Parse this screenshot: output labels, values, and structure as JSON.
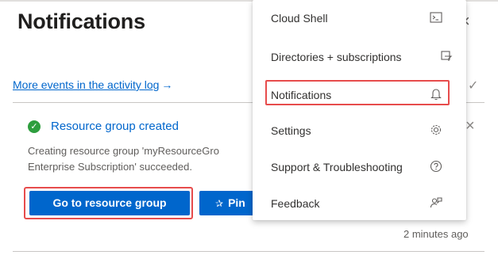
{
  "panel": {
    "title": "Notifications",
    "close_glyph": "×",
    "events_link": "More events in the activity log",
    "events_arrow": "→",
    "dismiss_all_glyph": "✓"
  },
  "notification": {
    "title": "Resource group created",
    "status_glyph": "✓",
    "close_glyph": "×",
    "description_line1": "Creating resource group 'myResourceGro",
    "description_line2": "Enterprise Subscription' succeeded.",
    "primary_button": "Go to resource group",
    "pin_button": "Pin",
    "pin_glyph": "✰",
    "timestamp": "2 minutes ago"
  },
  "menu": {
    "items": [
      {
        "label": "Cloud Shell",
        "icon": "cloud-shell-icon"
      },
      {
        "label": "Directories + subscriptions",
        "icon": "directory-filter-icon"
      },
      {
        "label": "Notifications",
        "icon": "bell-icon",
        "highlighted": true
      },
      {
        "label": "Settings",
        "icon": "gear-icon"
      },
      {
        "label": "Support & Troubleshooting",
        "icon": "help-icon"
      },
      {
        "label": "Feedback",
        "icon": "feedback-icon"
      }
    ]
  },
  "colors": {
    "accent": "#0066cc",
    "success": "#2e9e3e",
    "highlight": "#e74c4c"
  }
}
